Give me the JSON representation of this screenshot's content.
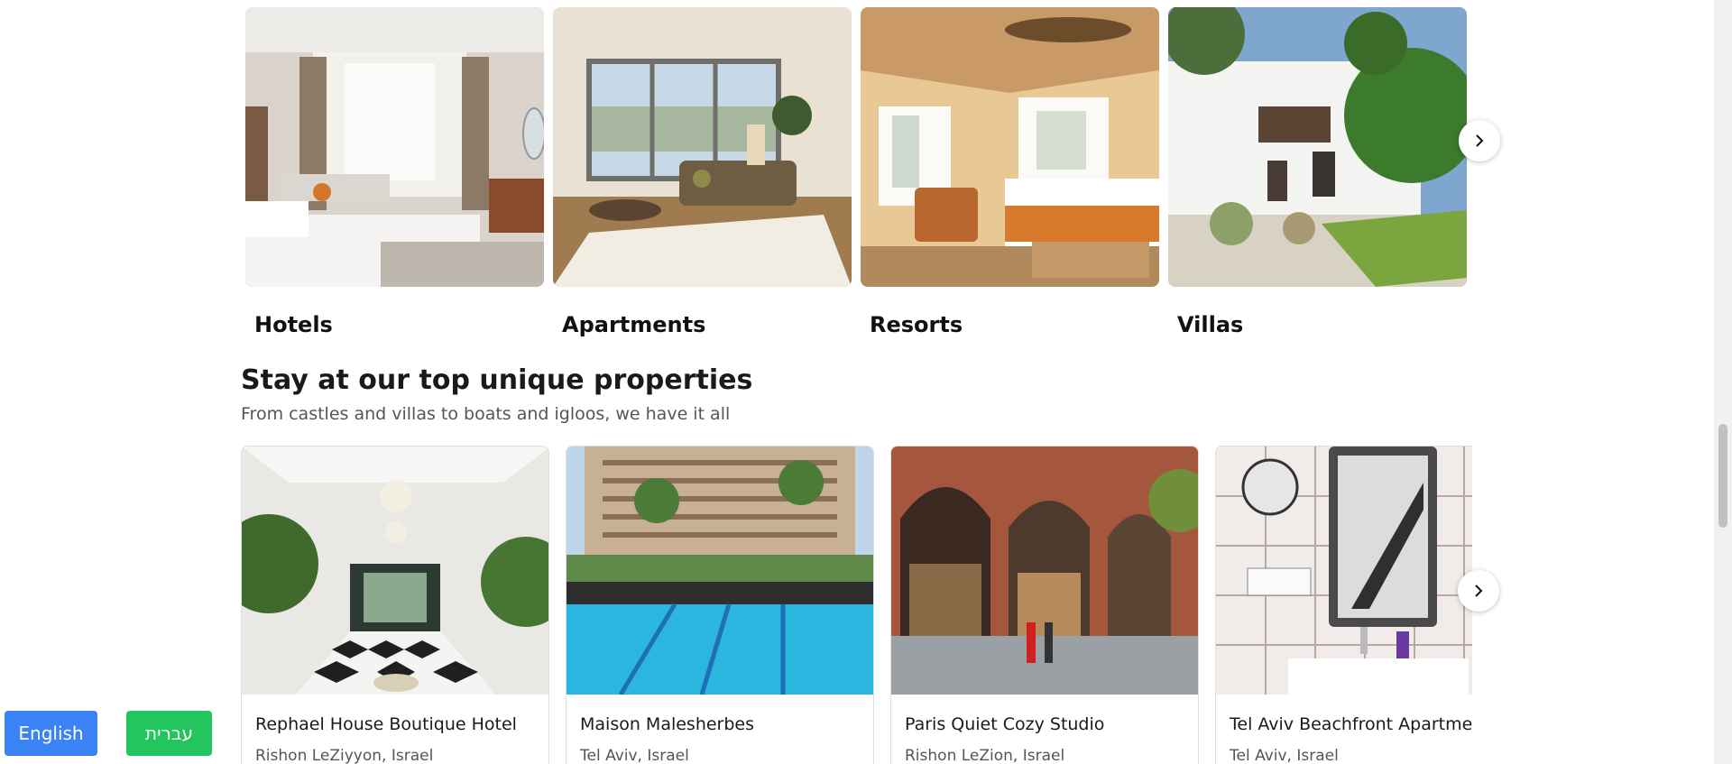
{
  "property_types": [
    {
      "label": "Hotels"
    },
    {
      "label": "Apartments"
    },
    {
      "label": "Resorts"
    },
    {
      "label": "Villas"
    }
  ],
  "unique_section": {
    "title": "Stay at our top unique properties",
    "subtitle": "From castles and villas to boats and igloos, we have it all"
  },
  "unique_properties": [
    {
      "name": "Rephael House Boutique Hotel",
      "location": "Rishon LeZiyyon, Israel"
    },
    {
      "name": "Maison Malesherbes",
      "location": "Tel Aviv, Israel"
    },
    {
      "name": "Paris Quiet Cozy Studio",
      "location": "Rishon LeZion, Israel"
    },
    {
      "name": "Tel Aviv Beachfront Apartment",
      "location": "Tel Aviv, Israel"
    }
  ],
  "language": {
    "english_label": "English",
    "hebrew_label": "עברית"
  },
  "colors": {
    "english_button": "#3b82f6",
    "hebrew_button": "#22c55e"
  },
  "icons": {
    "carousel_next": "chevron-right-icon"
  }
}
